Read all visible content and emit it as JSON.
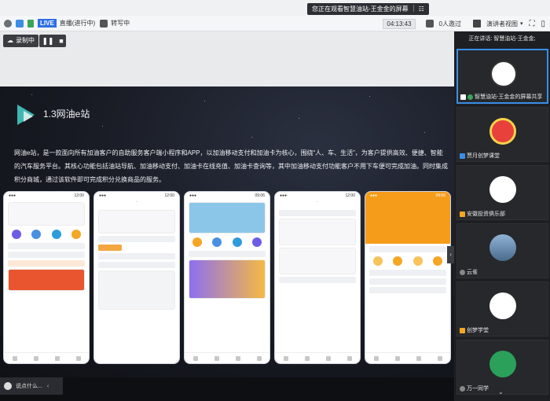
{
  "banner": {
    "text": "您正在观看智慧油站-王金金的屏幕"
  },
  "toolbar": {
    "live_badge": "LIVE",
    "live_status": "直播(进行中)",
    "transcribe": "转写中",
    "timer": "04:13:43",
    "attendees": "0人邀过",
    "view_mode": "演讲者视图"
  },
  "stage": {
    "recording_label": "录制中"
  },
  "slide": {
    "title": "1.3网油e站",
    "body": "网油e站，是一款面向所有加油客户的自助服务客户端小程序和APP，以加油移动支付和加油卡为核心，围绕“人、车、生活”，为客户提供高效、便捷、智能的汽车服务平台。其核心功能包括油站导航、加油移动支付、加油卡在线充值、加油卡查询等，其中加油移动支付功能客户不用下车便可完成加油。同时集成积分商城，通过该软件即可完成积分兑换商品的服务。"
  },
  "chat": {
    "preview": "说点什么..."
  },
  "side": {
    "speaking": "正在讲话: 智慧油站-王金金;",
    "participants": [
      {
        "name": "智慧油站-王金金的屏幕共享",
        "color": "#ffffff"
      },
      {
        "name": "贾月创梦课堂",
        "color": "#e8403a"
      },
      {
        "name": "安徽投资俱乐部",
        "color": "#ffffff"
      },
      {
        "name": "云雀",
        "color": "#4a6a8a"
      },
      {
        "name": "创梦学堂",
        "color": "#ffffff"
      },
      {
        "name": "万一同学",
        "color": "#2aa05a"
      }
    ]
  }
}
